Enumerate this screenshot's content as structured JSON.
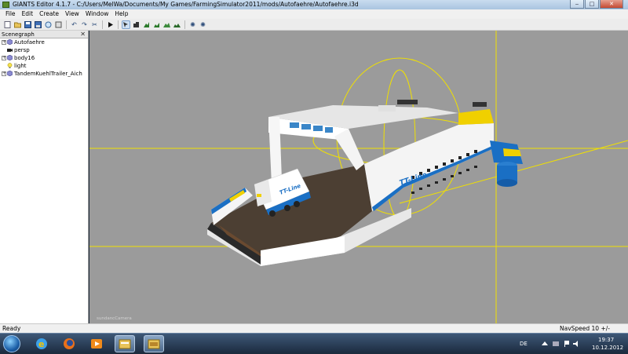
{
  "window": {
    "title": "GIANTS Editor 4.1.7 - C:/Users/MelWa/Documents/My Games/FarmingSimulator2011/mods/Autofaehre/Autofaehre.i3d",
    "minimize": "‒",
    "maximize": "□",
    "close": "✕"
  },
  "menu": [
    "File",
    "Edit",
    "Create",
    "View",
    "Window",
    "Help"
  ],
  "toolbar": {
    "buttons": [
      "new-file-icon",
      "open-icon",
      "save-icon",
      "save-as-icon",
      "import-icon",
      "export-icon",
      "undo-icon",
      "redo-icon",
      "cut-icon",
      "play-icon",
      "select-icon",
      "move-icon",
      "rotate-icon",
      "scale-icon",
      "terrain-icon",
      "paint-icon",
      "settings-icon",
      "camera-icon"
    ]
  },
  "scenegraph": {
    "title": "Scenegraph",
    "close": "✕",
    "items": [
      {
        "label": "Autofaehre",
        "icon": "transform-group-icon",
        "expander": "+"
      },
      {
        "label": "persp",
        "icon": "camera-icon",
        "expander": ""
      },
      {
        "label": "body16",
        "icon": "transform-group-icon",
        "expander": "+"
      },
      {
        "label": "light",
        "icon": "light-bulb-icon",
        "expander": ""
      },
      {
        "label": "TandemKuehlTrailer_Aich",
        "icon": "transform-group-icon",
        "expander": "+"
      }
    ]
  },
  "viewport": {
    "camera_label": "sundancCamera",
    "ship_logo": "TT-Line",
    "trailer_logo": "TT-Line",
    "background": "#9b9b9b",
    "gizmo_color": "#f0e000"
  },
  "status": {
    "ready": "Ready",
    "nav_speed": "NavSpeed 10 +/-"
  },
  "taskbar": {
    "language": "DE",
    "time": "19:37",
    "date": "10.12.2012",
    "apps": [
      "internet-explorer-icon",
      "firefox-icon",
      "media-player-icon",
      "explorer-icon",
      "giants-editor-icon"
    ]
  }
}
